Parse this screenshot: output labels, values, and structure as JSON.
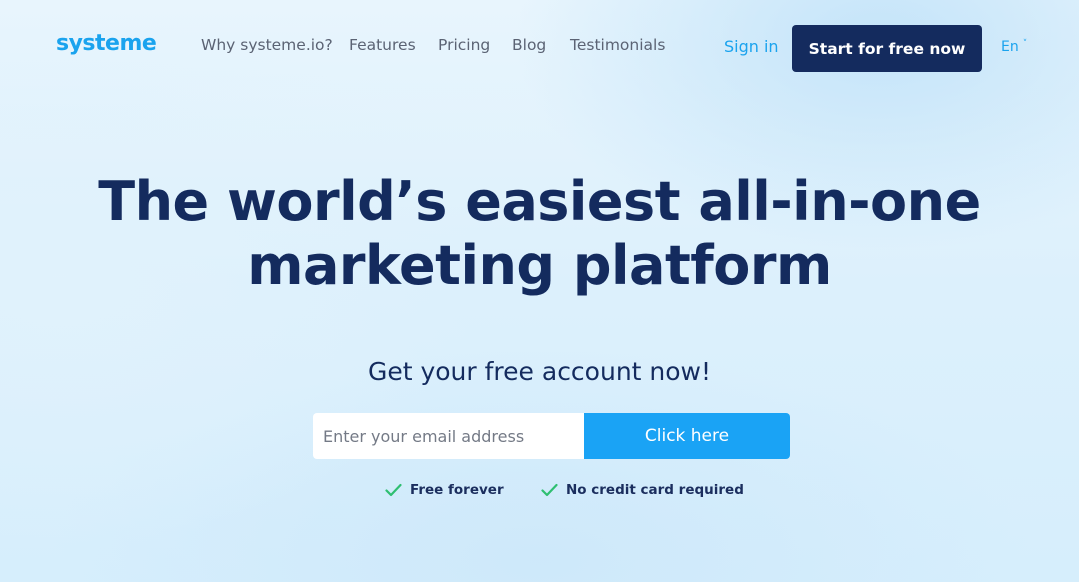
{
  "header": {
    "logo": "systeme",
    "nav": {
      "why": "Why systeme.io?",
      "features": "Features",
      "pricing": "Pricing",
      "blog": "Blog",
      "testimonials": "Testimonials"
    },
    "sign_in": "Sign in",
    "cta": "Start for free now",
    "language": "En",
    "language_icon": "chevron-down-icon"
  },
  "hero": {
    "title_line1": "The world’s easiest all-in-one",
    "title_line2": "marketing platform",
    "subtitle": "Get your free account now!"
  },
  "signup": {
    "email_placeholder": "Enter your email address",
    "email_value": "",
    "button_label": "Click here"
  },
  "perks": [
    {
      "icon": "check-icon",
      "label": "Free forever"
    },
    {
      "icon": "check-icon",
      "label": "No credit card required"
    }
  ],
  "colors": {
    "brand_blue": "#1aa3ee",
    "navy": "#142b5e",
    "button_blue": "#1aa3f5",
    "check_green": "#2fbf71"
  }
}
